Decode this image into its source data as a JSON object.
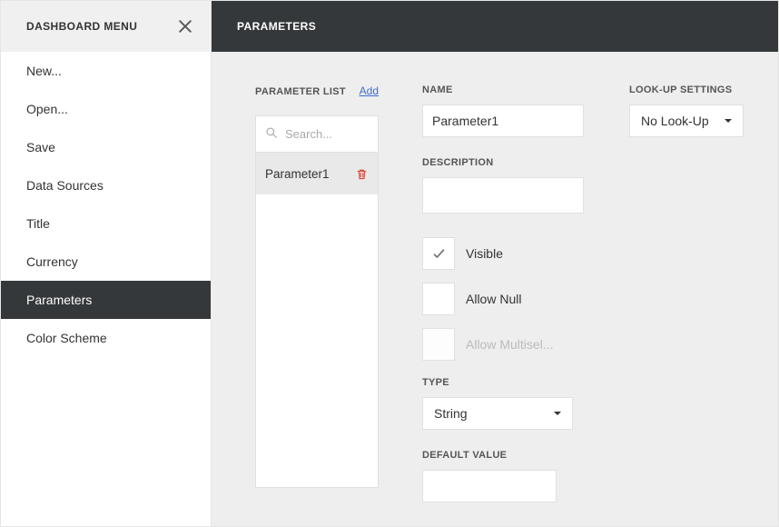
{
  "sidebar": {
    "title": "DASHBOARD MENU",
    "items": [
      {
        "label": "New..."
      },
      {
        "label": "Open..."
      },
      {
        "label": "Save"
      },
      {
        "label": "Data Sources"
      },
      {
        "label": "Title"
      },
      {
        "label": "Currency"
      },
      {
        "label": "Parameters"
      },
      {
        "label": "Color Scheme"
      }
    ]
  },
  "main": {
    "title": "PARAMETERS",
    "param_list": {
      "label": "PARAMETER LIST",
      "add_label": "Add",
      "search_placeholder": "Search...",
      "items": [
        {
          "name": "Parameter1"
        }
      ]
    },
    "name": {
      "label": "NAME",
      "value": "Parameter1"
    },
    "description": {
      "label": "DESCRIPTION",
      "value": ""
    },
    "checkboxes": {
      "visible": {
        "label": "Visible",
        "checked": true
      },
      "allow_null": {
        "label": "Allow Null",
        "checked": false
      },
      "allow_multiselect": {
        "label": "Allow Multisel...",
        "checked": false,
        "disabled": true
      }
    },
    "type": {
      "label": "TYPE",
      "value": "String"
    },
    "default_value": {
      "label": "DEFAULT VALUE",
      "value": ""
    },
    "lookup": {
      "label": "LOOK-UP SETTINGS",
      "value": "No Look-Up"
    }
  }
}
